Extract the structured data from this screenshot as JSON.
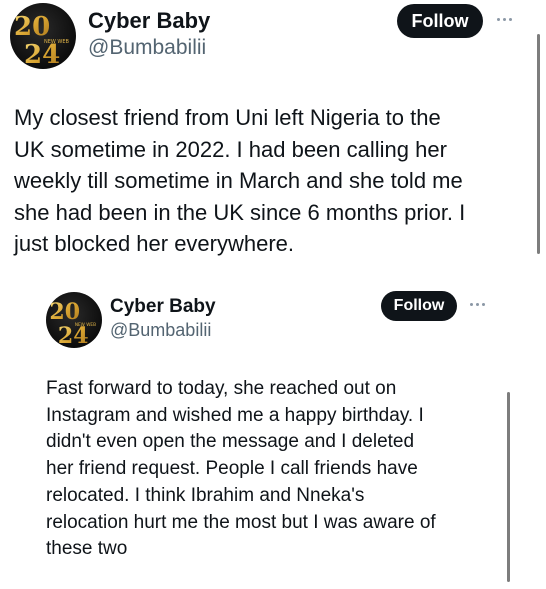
{
  "tweets": [
    {
      "author": {
        "name": "Cyber Baby",
        "handle": "@Bumbabilii",
        "avatar_icon": "gold-2024-avatar",
        "avatar_text": "2024",
        "avatar_subtext": "NEW WEB"
      },
      "follow_label": "Follow",
      "more_icon": "ellipsis-icon",
      "text": "My closest friend from Uni left Nigeria to the\nUK sometime in 2022. I had been calling her\nweekly till sometime in March and she told me\nshe had been in the UK since 6 months prior. I\njust blocked her everywhere."
    },
    {
      "author": {
        "name": "Cyber Baby",
        "handle": "@Bumbabilii",
        "avatar_icon": "gold-2024-avatar",
        "avatar_text": "2024",
        "avatar_subtext": "NEW WEB"
      },
      "follow_label": "Follow",
      "more_icon": "ellipsis-icon",
      "text": "Fast forward to today, she reached out on\nInstagram and wished me a happy birthday. I\ndidn't even open the message and I deleted\nher friend request. People I call friends have\nrelocated. I think Ibrahim and Nneka's\nrelocation hurt me the most but I was aware of\nthese two"
    }
  ],
  "colors": {
    "text": "#0f1419",
    "secondary": "#536471",
    "button_bg": "#0f1419",
    "button_text": "#ffffff",
    "avatar_gold": "#e0b447"
  }
}
